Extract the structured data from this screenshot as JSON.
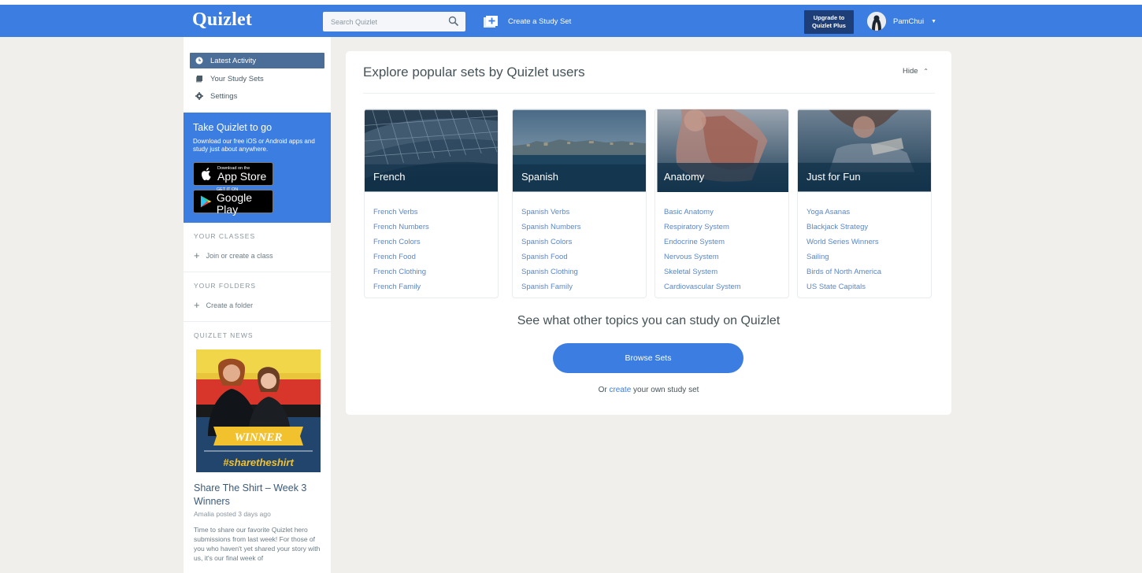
{
  "header": {
    "logo": "Quizlet",
    "search_placeholder": "Search Quizlet",
    "create_set": "Create a Study Set",
    "upgrade_line1": "Upgrade to",
    "upgrade_line2": "Quizlet Plus",
    "username": "PamChui",
    "brand_color": "#3b7de1"
  },
  "sidebar": {
    "nav": [
      {
        "label": "Latest Activity",
        "icon": "clock-icon"
      },
      {
        "label": "Your Study Sets",
        "icon": "book-icon"
      },
      {
        "label": "Settings",
        "icon": "gear-icon"
      }
    ],
    "promo": {
      "title": "Take Quizlet to go",
      "text": "Download our free iOS or Android apps and study just about anywhere.",
      "app_store_small": "Download on the",
      "app_store_big": "App Store",
      "google_play_small": "GET IT ON",
      "google_play_big": "Google Play"
    },
    "classes_label": "YOUR CLASSES",
    "classes_link": "Join or create a class",
    "folders_label": "YOUR FOLDERS",
    "folders_link": "Create a folder",
    "news_label": "QUIZLET NEWS",
    "news": {
      "banner_text": "WINNER",
      "hashtag": "#sharetheshirt",
      "title": "Share The Shirt – Week 3 Winners",
      "meta": "Amalia posted 3 days ago",
      "body": "Time to share our favorite Quizlet hero submissions from last week! For those of you who haven't yet shared your story with us, it's our final week of"
    }
  },
  "main": {
    "title": "Explore popular sets by Quizlet users",
    "hide": "Hide",
    "cards": [
      {
        "name": "French",
        "links": [
          "French Verbs",
          "French Numbers",
          "French Colors",
          "French Food",
          "French Clothing",
          "French Family"
        ]
      },
      {
        "name": "Spanish",
        "links": [
          "Spanish Verbs",
          "Spanish Numbers",
          "Spanish Colors",
          "Spanish Food",
          "Spanish Clothing",
          "Spanish Family"
        ]
      },
      {
        "name": "Anatomy",
        "links": [
          "Basic Anatomy",
          "Respiratory System",
          "Endocrine System",
          "Nervous System",
          "Skeletal System",
          "Cardiovascular System"
        ]
      },
      {
        "name": "Just for Fun",
        "links": [
          "Yoga Asanas",
          "Blackjack Strategy",
          "World Series Winners",
          "Sailing",
          "Birds of North America",
          "US State Capitals"
        ]
      }
    ],
    "see_other": "See what other topics you can study on Quizlet",
    "browse": "Browse Sets",
    "or_prefix": "Or",
    "create_link": "create",
    "or_suffix": "your own study set"
  }
}
